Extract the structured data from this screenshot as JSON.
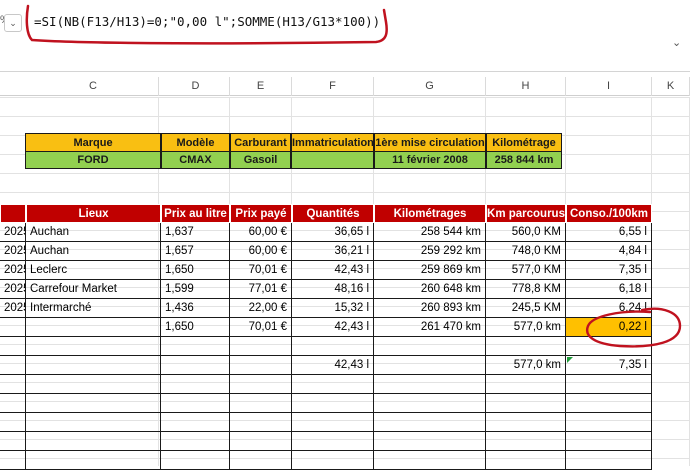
{
  "formula_bar": {
    "formula": "=SI(NB(F13/H13)=0;\"0,00 l\";SOMME(H13/G13*100))",
    "name_box_fragment": "%",
    "dropdown_glyph": "⌄",
    "expand_glyph": "⌄"
  },
  "columns": [
    "C",
    "D",
    "E",
    "F",
    "G",
    "H",
    "I",
    "K"
  ],
  "info_box": {
    "headers": [
      "Marque",
      "Modèle",
      "Carburant",
      "Immatriculation",
      "1ère mise circulation",
      "Kilométrage"
    ],
    "values": [
      "FORD",
      "CMAX",
      "Gasoil",
      "",
      "11 février 2008",
      "258 844   km"
    ]
  },
  "table": {
    "headers": [
      "Lieux",
      "Prix au litre",
      "Prix payé",
      "Quantités",
      "Kilométrages",
      "Km parcourus",
      "Conso./100km"
    ],
    "rows": [
      {
        "date": "2025",
        "lieu": "Auchan",
        "prix_litre": "1,637",
        "prix_paye": "60,00 €",
        "quantite": "36,65 l",
        "km": "258 544   km",
        "parcourus": "560,0 KM",
        "conso": "6,55 l"
      },
      {
        "date": "2025",
        "lieu": "Auchan",
        "prix_litre": "1,657",
        "prix_paye": "60,00 €",
        "quantite": "36,21 l",
        "km": "259 292   km",
        "parcourus": "748,0 KM",
        "conso": "4,84 l"
      },
      {
        "date": "2025",
        "lieu": "Leclerc",
        "prix_litre": "1,650",
        "prix_paye": "70,01 €",
        "quantite": "42,43 l",
        "km": "259 869   km",
        "parcourus": "577,0 KM",
        "conso": "7,35 l"
      },
      {
        "date": "2025",
        "lieu": "Carrefour Market",
        "prix_litre": "1,599",
        "prix_paye": "77,01 €",
        "quantite": "48,16 l",
        "km": "260 648   km",
        "parcourus": "778,8 KM",
        "conso": "6,18 l"
      },
      {
        "date": "2025",
        "lieu": "Intermarché",
        "prix_litre": "1,436",
        "prix_paye": "22,00 €",
        "quantite": "15,32 l",
        "km": "260 893   km",
        "parcourus": "245,5 KM",
        "conso": "6,24 l"
      },
      {
        "date": "",
        "lieu": "",
        "prix_litre": "1,650",
        "prix_paye": "70,01 €",
        "quantite": "42,43 l",
        "km": "261 470   km",
        "parcourus": "577,0 km",
        "conso": "0,22 l"
      },
      {
        "date": "",
        "lieu": "",
        "prix_litre": "",
        "prix_paye": "",
        "quantite": "",
        "km": "",
        "parcourus": "",
        "conso": ""
      },
      {
        "date": "",
        "lieu": "",
        "prix_litre": "",
        "prix_paye": "",
        "quantite": "42,43 l",
        "km": "",
        "parcourus": "577,0 km",
        "conso": "7,35 l"
      },
      {
        "date": "",
        "lieu": "",
        "prix_litre": "",
        "prix_paye": "",
        "quantite": "",
        "km": "",
        "parcourus": "",
        "conso": ""
      },
      {
        "date": "",
        "lieu": "",
        "prix_litre": "",
        "prix_paye": "",
        "quantite": "",
        "km": "",
        "parcourus": "",
        "conso": ""
      },
      {
        "date": "",
        "lieu": "",
        "prix_litre": "",
        "prix_paye": "",
        "quantite": "",
        "km": "",
        "parcourus": "",
        "conso": ""
      },
      {
        "date": "",
        "lieu": "",
        "prix_litre": "",
        "prix_paye": "",
        "quantite": "",
        "km": "",
        "parcourus": "",
        "conso": ""
      },
      {
        "date": "",
        "lieu": "",
        "prix_litre": "",
        "prix_paye": "",
        "quantite": "",
        "km": "",
        "parcourus": "",
        "conso": ""
      }
    ],
    "highlight_color": "#ffc000",
    "header_color": "#c00000"
  },
  "annotation_color": "#c0121f"
}
